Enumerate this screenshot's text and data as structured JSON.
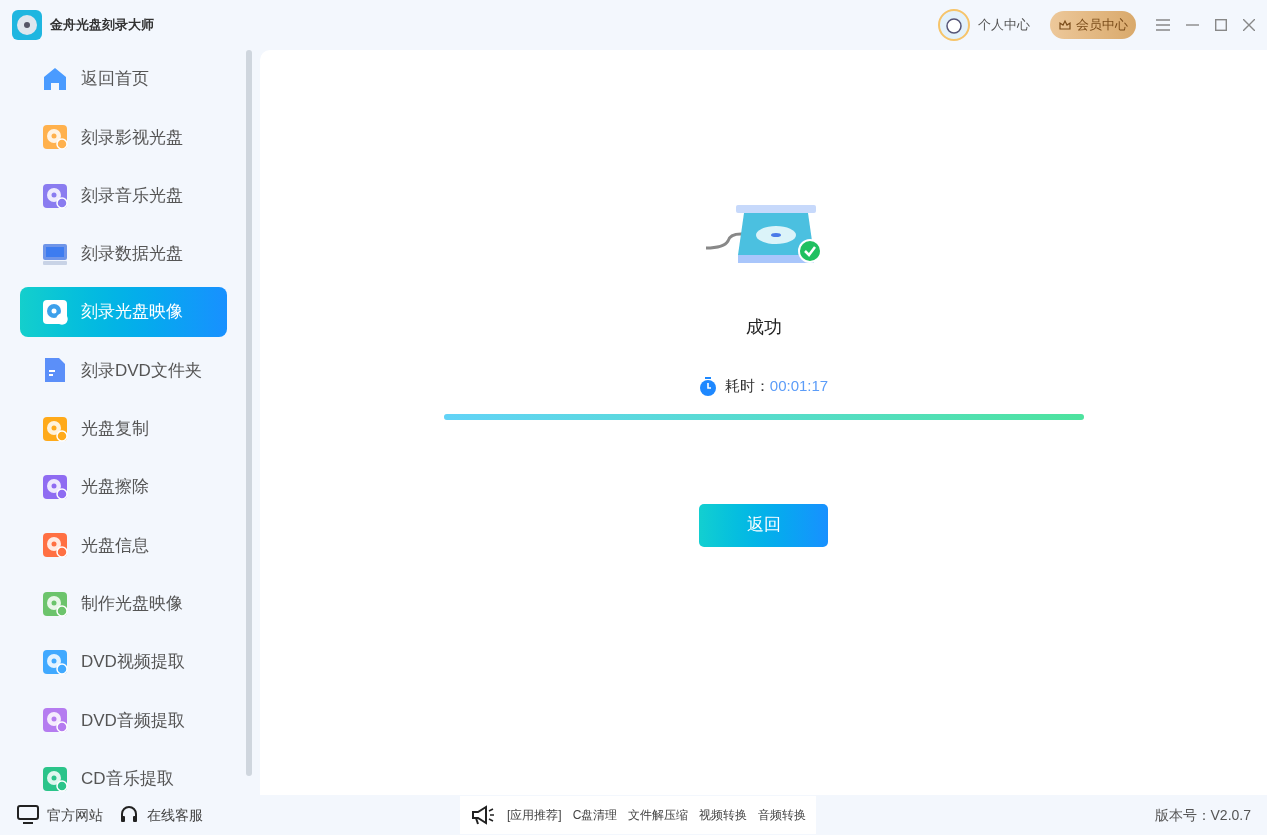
{
  "window": {
    "title": "金舟光盘刻录大师"
  },
  "header": {
    "user_center": "个人中心",
    "vip_center": "会员中心"
  },
  "sidebar": {
    "items": [
      {
        "label": "返回首页",
        "kind": "home",
        "color": "#4a9bff",
        "selected": false
      },
      {
        "label": "刻录影视光盘",
        "kind": "disc",
        "color": "#ffb14d",
        "selected": false
      },
      {
        "label": "刻录音乐光盘",
        "kind": "disc",
        "color": "#8a7cf0",
        "selected": false
      },
      {
        "label": "刻录数据光盘",
        "kind": "monitor",
        "color": "#6f95e8",
        "selected": false
      },
      {
        "label": "刻录光盘映像",
        "kind": "disc",
        "color": "#ffffff",
        "selected": true
      },
      {
        "label": "刻录DVD文件夹",
        "kind": "file",
        "color": "#5b8ff9",
        "selected": false
      },
      {
        "label": "光盘复制",
        "kind": "disc",
        "color": "#ffaa1a",
        "selected": false
      },
      {
        "label": "光盘擦除",
        "kind": "disc",
        "color": "#8f6cf2",
        "selected": false
      },
      {
        "label": "光盘信息",
        "kind": "disc",
        "color": "#ff7043",
        "selected": false
      },
      {
        "label": "制作光盘映像",
        "kind": "disc",
        "color": "#6cc46c",
        "selected": false
      },
      {
        "label": "DVD视频提取",
        "kind": "disc",
        "color": "#40a9ff",
        "selected": false
      },
      {
        "label": "DVD音频提取",
        "kind": "disc",
        "color": "#b57cf0",
        "selected": false
      },
      {
        "label": "CD音乐提取",
        "kind": "disc",
        "color": "#2bc48a",
        "selected": false
      }
    ]
  },
  "result": {
    "status": "成功",
    "elapsed_label": "耗时：",
    "elapsed": "00:01:17",
    "level": 1,
    "back_button": "返回"
  },
  "footer": {
    "links": [
      "官方网站",
      "在线客服"
    ],
    "recommend_label": "[应用推荐]",
    "apps": [
      "C盘清理",
      "文件解压缩",
      "视频转换",
      "音频转换"
    ],
    "version": "版本号：V2.0.7"
  }
}
